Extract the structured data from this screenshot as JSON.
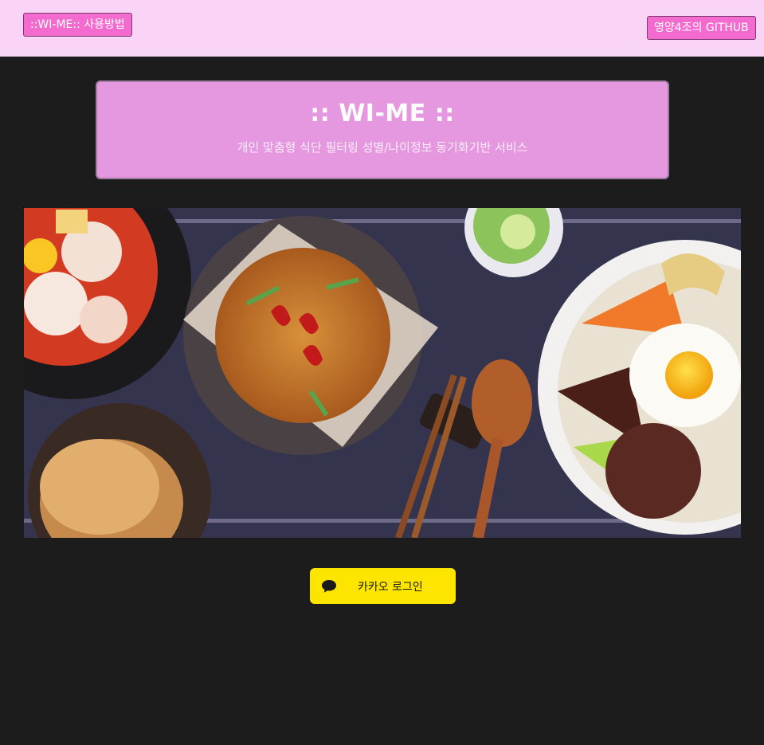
{
  "header": {
    "usage_label": "::WI-ME:: 사용방법",
    "github_label": "영양4조의 GITHUB"
  },
  "hero": {
    "title": ":: WI-ME ::",
    "subtitle": "개인 맞춤형 식단 필터링 성별/나이정보 동기화기반 서비스"
  },
  "banner": {
    "image": "korean-food-table-illustration"
  },
  "login": {
    "kakao_label": "카카오 로그인",
    "icon": "speech-bubble-icon"
  },
  "colors": {
    "topbar": "#fad4f7",
    "nav_button": "#f46bd0",
    "hero_bg": "#e597df",
    "page_bg": "#1c1c1c",
    "kakao": "#fee500"
  }
}
